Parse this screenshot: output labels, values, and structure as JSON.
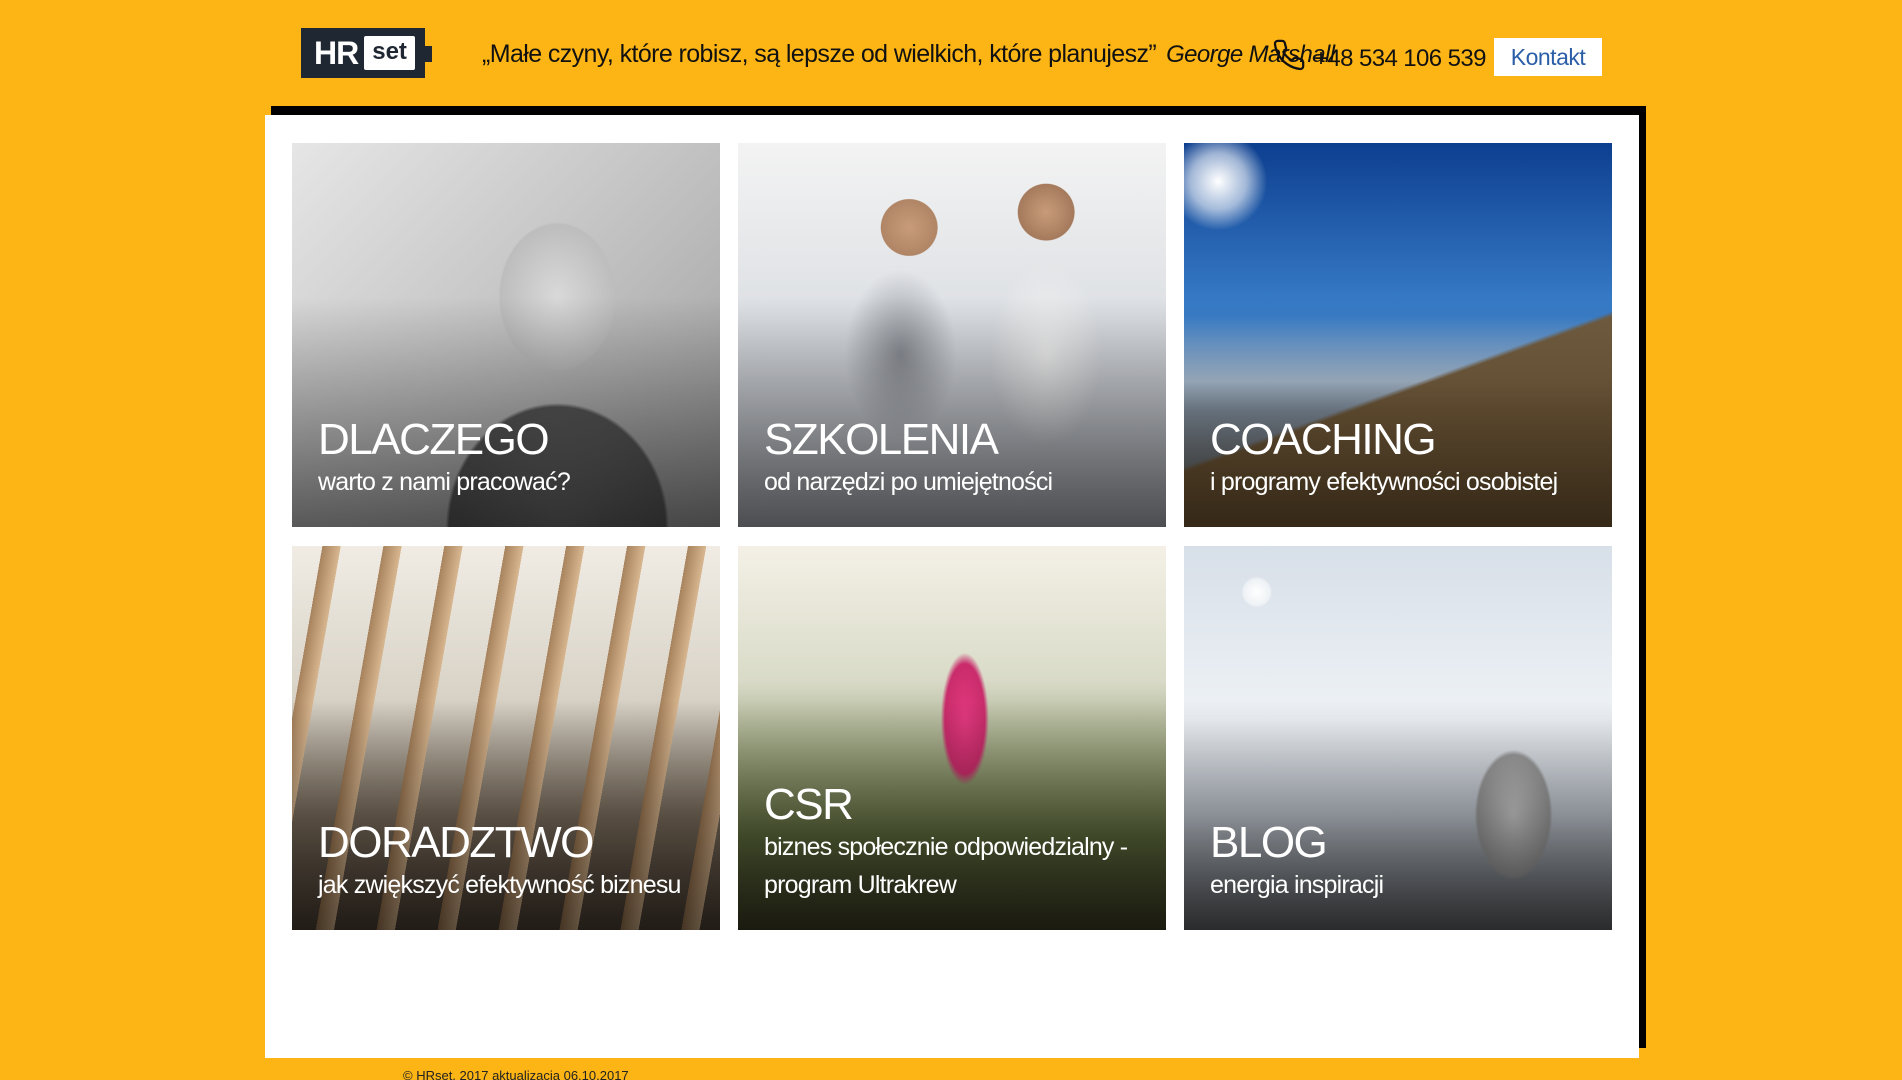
{
  "header": {
    "logo": {
      "hr": "HR",
      "set": "set"
    },
    "quote": "„Małe czyny, które robisz, są lepsze od wielkich, które planujesz”",
    "quote_author": "George Marshall",
    "phone": "+48 534 106 539",
    "contact_label": "Kontakt"
  },
  "tiles": [
    {
      "title": "DLACZEGO",
      "subtitle": "warto z nami pracować?"
    },
    {
      "title": "SZKOLENIA",
      "subtitle": "od narzędzi po umiejętności"
    },
    {
      "title": "COACHING",
      "subtitle": "i programy efektywności osobistej"
    },
    {
      "title": "DORADZTWO",
      "subtitle": "jak zwiększyć efektywność biznesu"
    },
    {
      "title": "CSR",
      "subtitle": "biznes społecznie odpowiedzialny - program Ultrakrew"
    },
    {
      "title": "BLOG",
      "subtitle": "energia inspiracji"
    }
  ],
  "footer": "© HRset, 2017 aktualizacja 06.10.2017",
  "colors": {
    "background": "#FDB515",
    "logo_dark": "#1f2733",
    "contact_text": "#2b5ea7"
  }
}
